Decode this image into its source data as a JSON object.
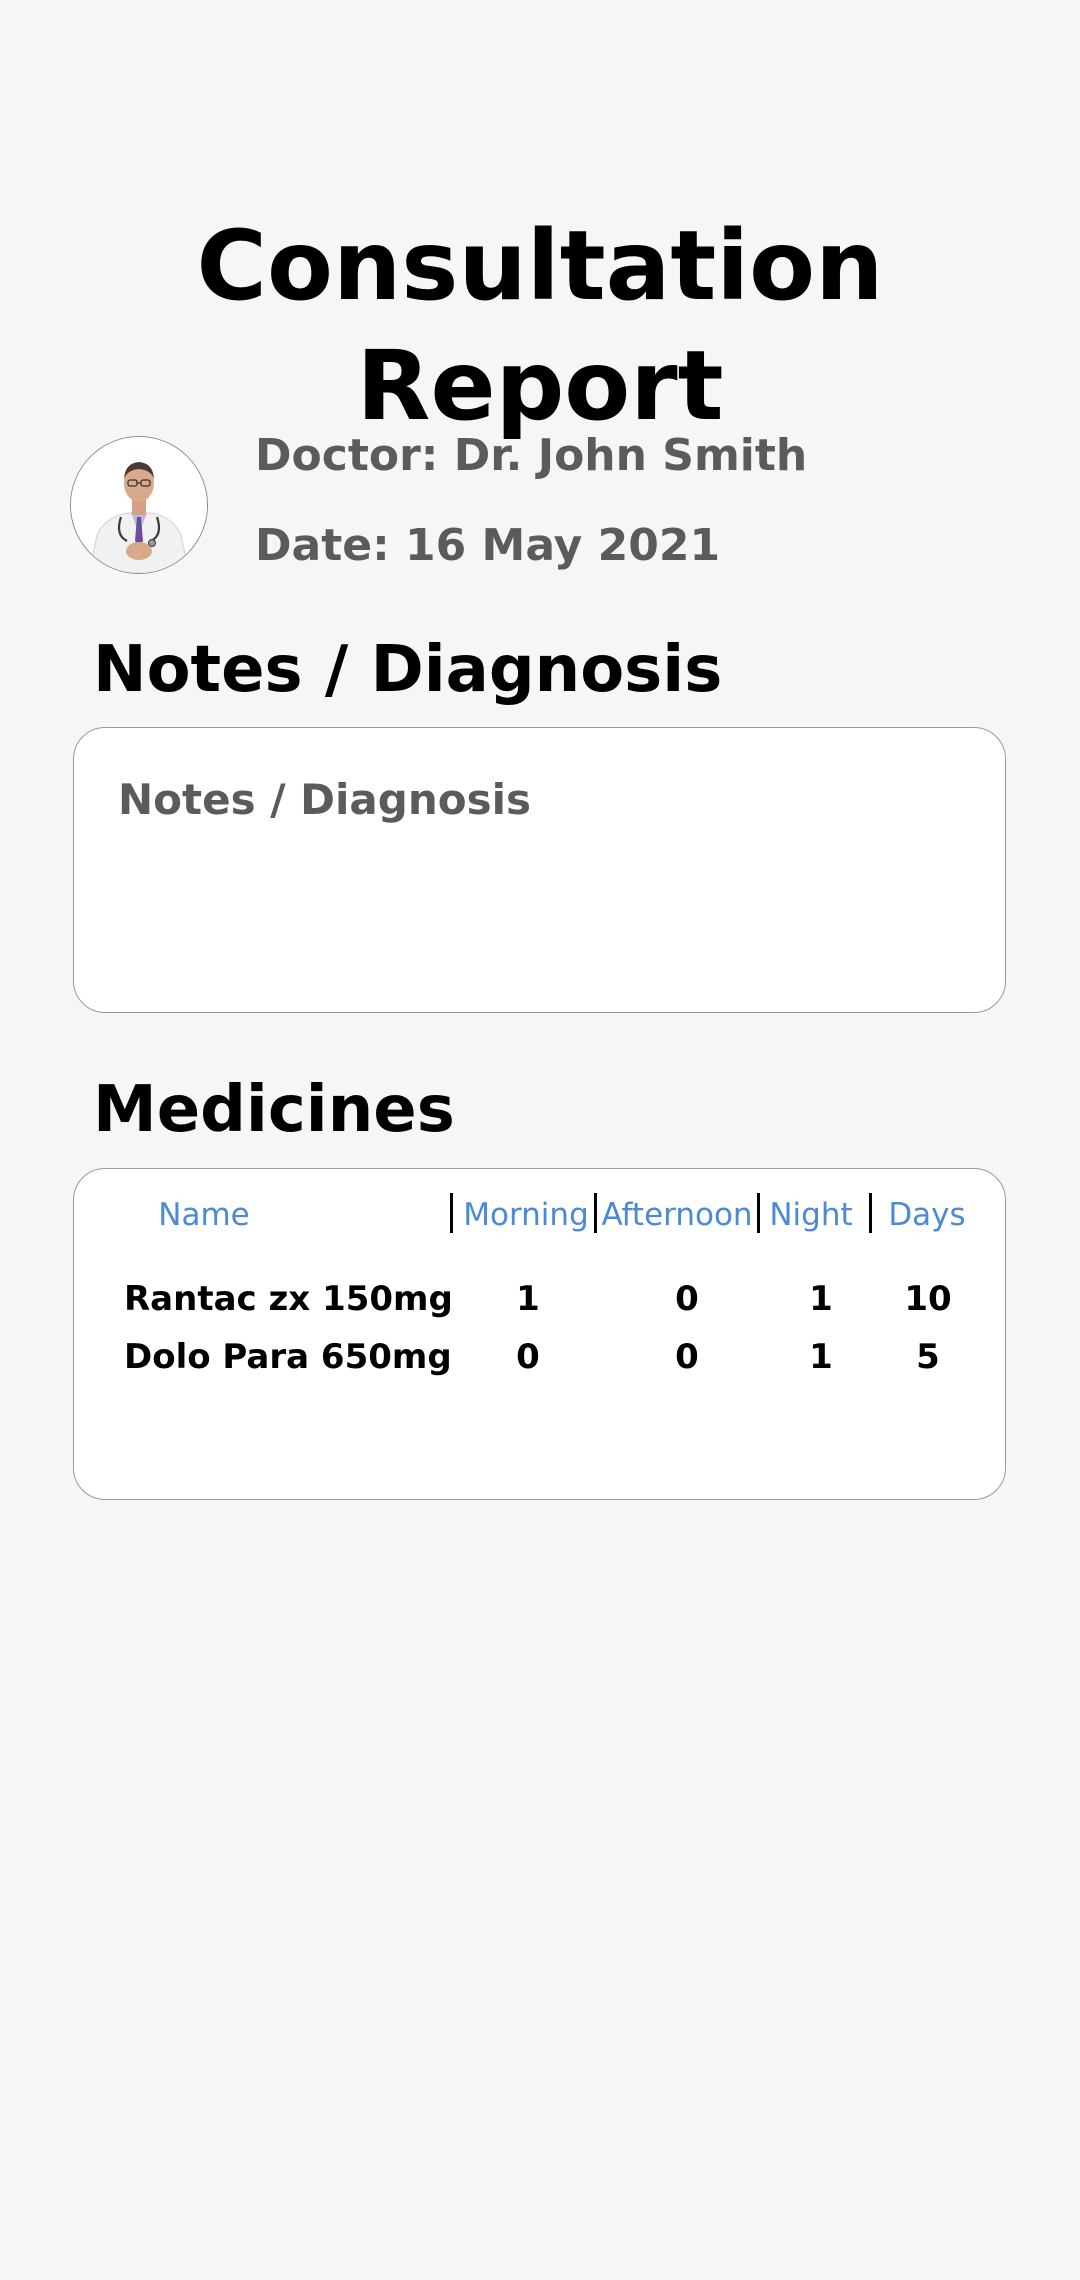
{
  "page": {
    "title": "Consultation Report"
  },
  "doctor": {
    "label": "Doctor: Dr. John Smith",
    "date": "Date: 16 May 2021",
    "avatar": "doctor-avatar"
  },
  "notes": {
    "heading": "Notes / Diagnosis",
    "placeholder": "Notes / Diagnosis",
    "value": ""
  },
  "medicines": {
    "heading": "Medicines",
    "columns": [
      "Name",
      "Morning",
      "Afternoon",
      "Night",
      "Days"
    ],
    "rows": [
      [
        "Rantac zx 150mg",
        "1",
        "0",
        "1",
        "10"
      ],
      [
        "Dolo Para 650mg",
        "0",
        "0",
        "1",
        "5"
      ]
    ]
  },
  "colors": {
    "background": "#f6f6f6",
    "header_accent": "#4a8ad6",
    "secondary_text": "#5b5b5b"
  }
}
